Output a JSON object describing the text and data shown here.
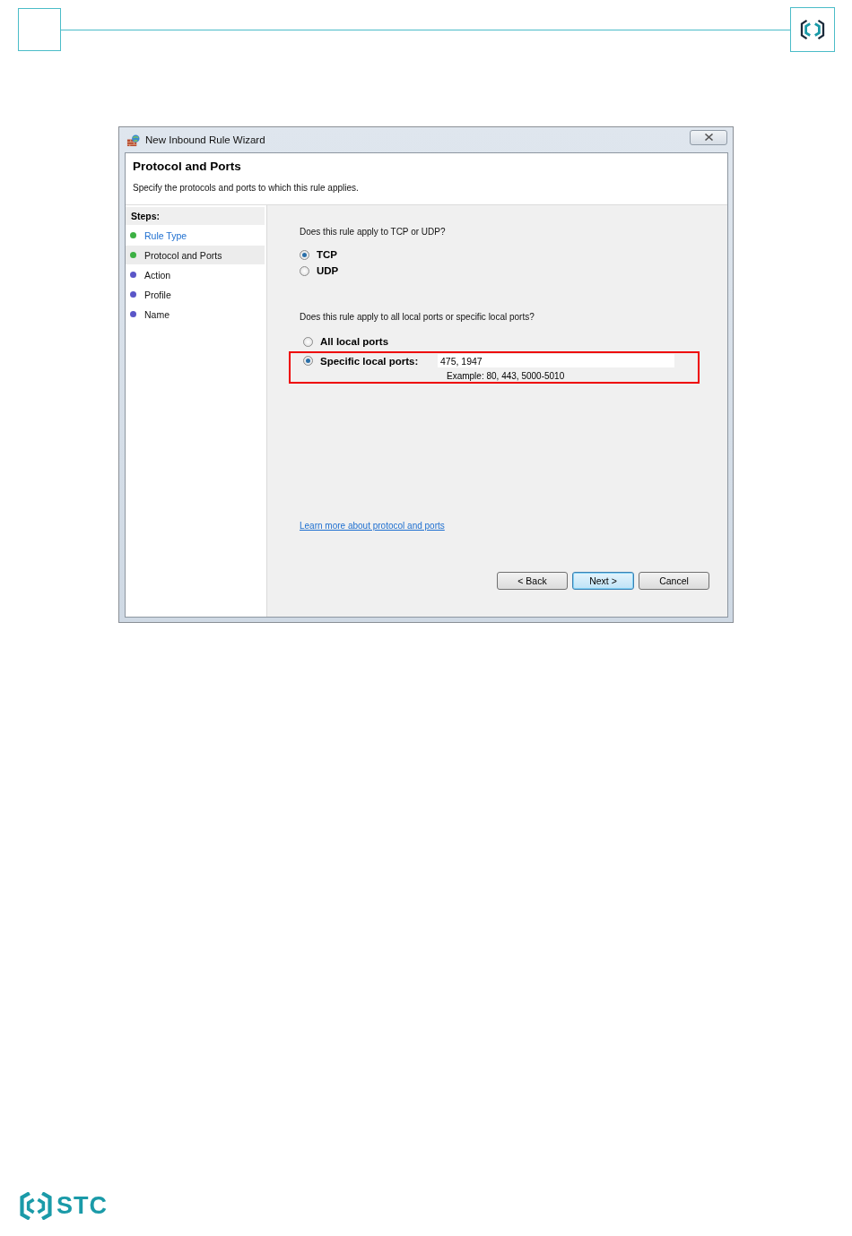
{
  "footer": {
    "brand": "STC"
  },
  "window": {
    "title": "New Inbound Rule Wizard"
  },
  "header": {
    "title": "Protocol and Ports",
    "description": "Specify the protocols and ports to which this rule applies."
  },
  "steps": {
    "label": "Steps:",
    "items": [
      {
        "label": "Rule Type",
        "color": "#3cb043",
        "visited": true,
        "selected": false
      },
      {
        "label": "Protocol and Ports",
        "color": "#3cb043",
        "visited": false,
        "selected": true
      },
      {
        "label": "Action",
        "color": "#5a56c8",
        "visited": false,
        "selected": false
      },
      {
        "label": "Profile",
        "color": "#5a56c8",
        "visited": false,
        "selected": false
      },
      {
        "label": "Name",
        "color": "#5a56c8",
        "visited": false,
        "selected": false
      }
    ]
  },
  "protocol": {
    "question": "Does this rule apply to TCP or UDP?",
    "options": [
      {
        "label": "TCP",
        "selected": true
      },
      {
        "label": "UDP",
        "selected": false
      }
    ]
  },
  "ports": {
    "question": "Does this rule apply to all local ports or specific local ports?",
    "options": [
      {
        "label": "All local ports",
        "selected": false,
        "highlighted": false
      },
      {
        "label": "Specific local ports:",
        "selected": true,
        "highlighted": true,
        "value": "475, 1947",
        "example": "Example: 80, 443, 5000-5010"
      }
    ]
  },
  "link": "Learn more about protocol and ports",
  "buttons": [
    {
      "label": "< Back",
      "default": false
    },
    {
      "label": "Next >",
      "default": true
    },
    {
      "label": "Cancel",
      "default": false
    }
  ]
}
